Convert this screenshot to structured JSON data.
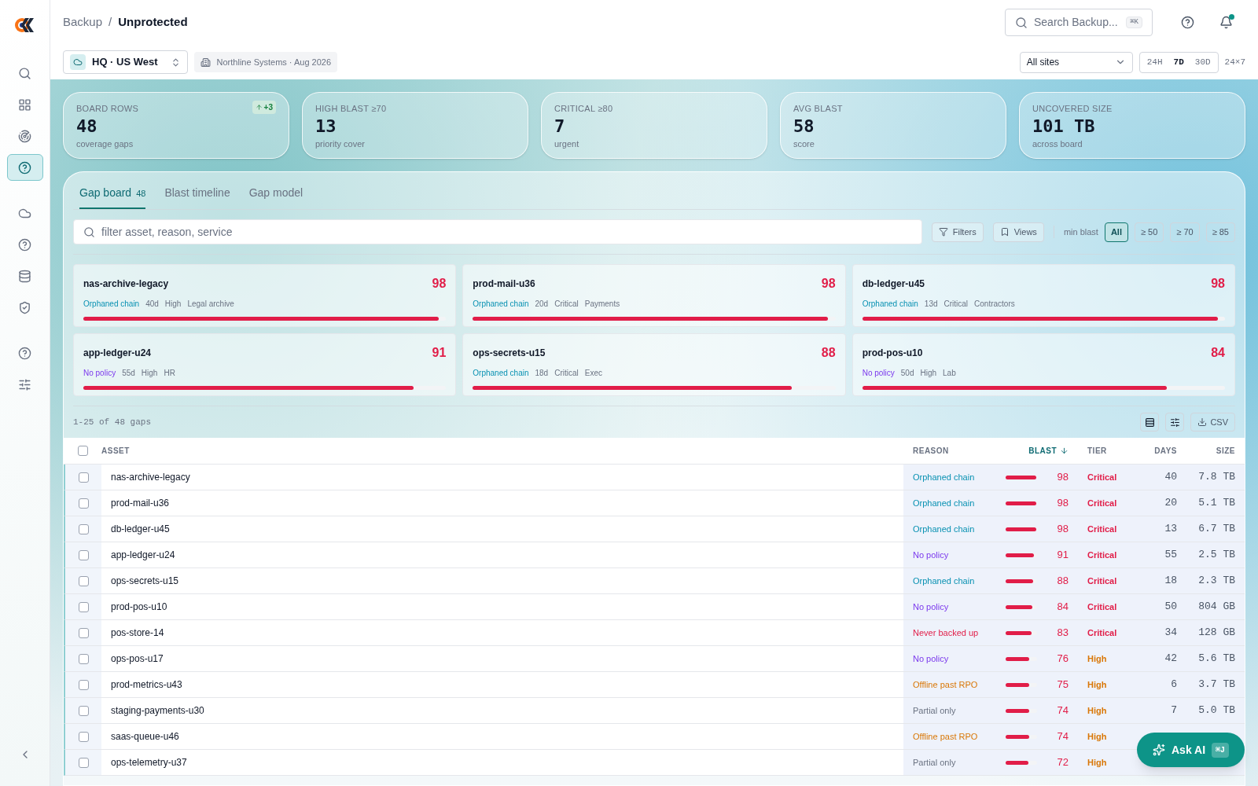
{
  "breadcrumb": {
    "parent": "Backup",
    "separator": "/",
    "current": "Unprotected"
  },
  "search": {
    "placeholder": "Search Backup...",
    "shortcut": "⌘K"
  },
  "notifications": {
    "unread": true
  },
  "sidebar": {
    "items": [
      {
        "kind": "search",
        "selected": false
      },
      {
        "kind": "grid",
        "selected": false
      },
      {
        "kind": "radar",
        "selected": false
      },
      {
        "kind": "help",
        "selected": true
      },
      {
        "kind": "cloud",
        "selected": false
      },
      {
        "kind": "help",
        "selected": false
      },
      {
        "kind": "database",
        "selected": false
      },
      {
        "kind": "shield",
        "selected": false
      },
      {
        "kind": "help",
        "selected": false
      },
      {
        "kind": "sliders",
        "selected": false
      }
    ]
  },
  "toolbar": {
    "site": "HQ · US West",
    "org": "Northline Systems · Aug 2026",
    "sites_select": "All sites",
    "ranges": [
      {
        "label": "24H",
        "selected": false
      },
      {
        "label": "7D",
        "selected": true
      },
      {
        "label": "30D",
        "selected": false
      }
    ],
    "coverage": "24×7"
  },
  "kpis": [
    {
      "label": "BOARD ROWS",
      "value": "48",
      "sub": "coverage gaps",
      "delta": "+3"
    },
    {
      "label": "HIGH BLAST ≥70",
      "value": "13",
      "sub": "priority cover"
    },
    {
      "label": "CRITICAL ≥80",
      "value": "7",
      "sub": "urgent"
    },
    {
      "label": "AVG BLAST",
      "value": "58",
      "sub": "score"
    },
    {
      "label": "UNCOVERED SIZE",
      "value": "101 TB",
      "sub": "across board"
    }
  ],
  "tabs": [
    {
      "label": "Gap board",
      "count": "48",
      "selected": true
    },
    {
      "label": "Blast timeline",
      "selected": false
    },
    {
      "label": "Gap model",
      "selected": false
    }
  ],
  "filter": {
    "placeholder": "filter asset, reason, service",
    "buttons": [
      "Filters",
      "Views"
    ],
    "min_label": "min blast",
    "chips": [
      {
        "label": "All",
        "selected": true
      },
      {
        "label": "≥ 50",
        "selected": false
      },
      {
        "label": "≥ 70",
        "selected": false
      },
      {
        "label": "≥ 85",
        "selected": false
      }
    ]
  },
  "cards": [
    {
      "name": "nas-archive-legacy",
      "score": "98",
      "reason": "Orphaned chain",
      "kind": "orphaned",
      "days": "40d",
      "tier": "High",
      "group": "Legal archive",
      "level": 0.98
    },
    {
      "name": "prod-mail-u36",
      "score": "98",
      "reason": "Orphaned chain",
      "kind": "orphaned",
      "days": "20d",
      "tier": "Critical",
      "group": "Payments",
      "level": 0.98
    },
    {
      "name": "db-ledger-u45",
      "score": "98",
      "reason": "Orphaned chain",
      "kind": "orphaned",
      "days": "13d",
      "tier": "Critical",
      "group": "Contractors",
      "level": 0.98
    },
    {
      "name": "app-ledger-u24",
      "score": "91",
      "reason": "No policy",
      "kind": "nopolicy",
      "days": "55d",
      "tier": "High",
      "group": "HR",
      "level": 0.91
    },
    {
      "name": "ops-secrets-u15",
      "score": "88",
      "reason": "Orphaned chain",
      "kind": "orphaned",
      "days": "18d",
      "tier": "Critical",
      "group": "Exec",
      "level": 0.88
    },
    {
      "name": "prod-pos-u10",
      "score": "84",
      "reason": "No policy",
      "kind": "nopolicy",
      "days": "50d",
      "tier": "High",
      "group": "Lab",
      "level": 0.84
    }
  ],
  "pagination": "1-25 of 48 gaps",
  "csv": "CSV",
  "table": {
    "all_checked": false,
    "columns": [
      "ASSET",
      "REASON",
      "BLAST",
      "TIER",
      "DAYS",
      "SIZE"
    ],
    "rows": [
      {
        "asset": "nas-archive-legacy",
        "reason": "Orphaned chain",
        "kind": "orphaned",
        "level": 0.98,
        "blast": "98",
        "tier": "Critical",
        "critical": true,
        "days": "40",
        "size": "7.8 TB",
        "checked": false
      },
      {
        "asset": "prod-mail-u36",
        "reason": "Orphaned chain",
        "kind": "orphaned",
        "level": 0.98,
        "blast": "98",
        "tier": "Critical",
        "critical": true,
        "days": "20",
        "size": "5.1 TB",
        "checked": false
      },
      {
        "asset": "db-ledger-u45",
        "reason": "Orphaned chain",
        "kind": "orphaned",
        "level": 0.98,
        "blast": "98",
        "tier": "Critical",
        "critical": true,
        "days": "13",
        "size": "6.7 TB",
        "checked": false
      },
      {
        "asset": "app-ledger-u24",
        "reason": "No policy",
        "kind": "nopolicy",
        "level": 0.91,
        "blast": "91",
        "tier": "Critical",
        "critical": true,
        "days": "55",
        "size": "2.5 TB",
        "checked": false
      },
      {
        "asset": "ops-secrets-u15",
        "reason": "Orphaned chain",
        "kind": "orphaned",
        "level": 0.88,
        "blast": "88",
        "tier": "Critical",
        "critical": true,
        "days": "18",
        "size": "2.3 TB",
        "checked": false
      },
      {
        "asset": "prod-pos-u10",
        "reason": "No policy",
        "kind": "nopolicy",
        "level": 0.84,
        "blast": "84",
        "tier": "Critical",
        "critical": true,
        "days": "50",
        "size": "804 GB",
        "checked": false
      },
      {
        "asset": "pos-store-14",
        "reason": "Never backed up",
        "kind": "never",
        "level": 0.83,
        "blast": "83",
        "tier": "Critical",
        "critical": true,
        "days": "34",
        "size": "128 GB",
        "checked": false
      },
      {
        "asset": "ops-pos-u17",
        "reason": "No policy",
        "kind": "nopolicy",
        "level": 0.76,
        "blast": "76",
        "tier": "High",
        "critical": false,
        "days": "42",
        "size": "5.6 TB",
        "checked": false
      },
      {
        "asset": "prod-metrics-u43",
        "reason": "Offline past RPO",
        "kind": "offline",
        "level": 0.75,
        "blast": "75",
        "tier": "High",
        "critical": false,
        "days": "6",
        "size": "3.7 TB",
        "checked": false
      },
      {
        "asset": "staging-payments-u30",
        "reason": "Partial only",
        "kind": "partial",
        "level": 0.74,
        "blast": "74",
        "tier": "High",
        "critical": false,
        "days": "7",
        "size": "5.0 TB",
        "checked": false
      },
      {
        "asset": "saas-queue-u46",
        "reason": "Offline past RPO",
        "kind": "offline",
        "level": 0.74,
        "blast": "74",
        "tier": "High",
        "critical": false,
        "checked": false
      },
      {
        "asset": "ops-telemetry-u37",
        "reason": "Partial only",
        "kind": "partial",
        "level": 0.72,
        "blast": "72",
        "tier": "High",
        "critical": false,
        "checked": false
      }
    ]
  },
  "assistant": {
    "label": "Ask AI",
    "shortcut": "⌘J"
  }
}
